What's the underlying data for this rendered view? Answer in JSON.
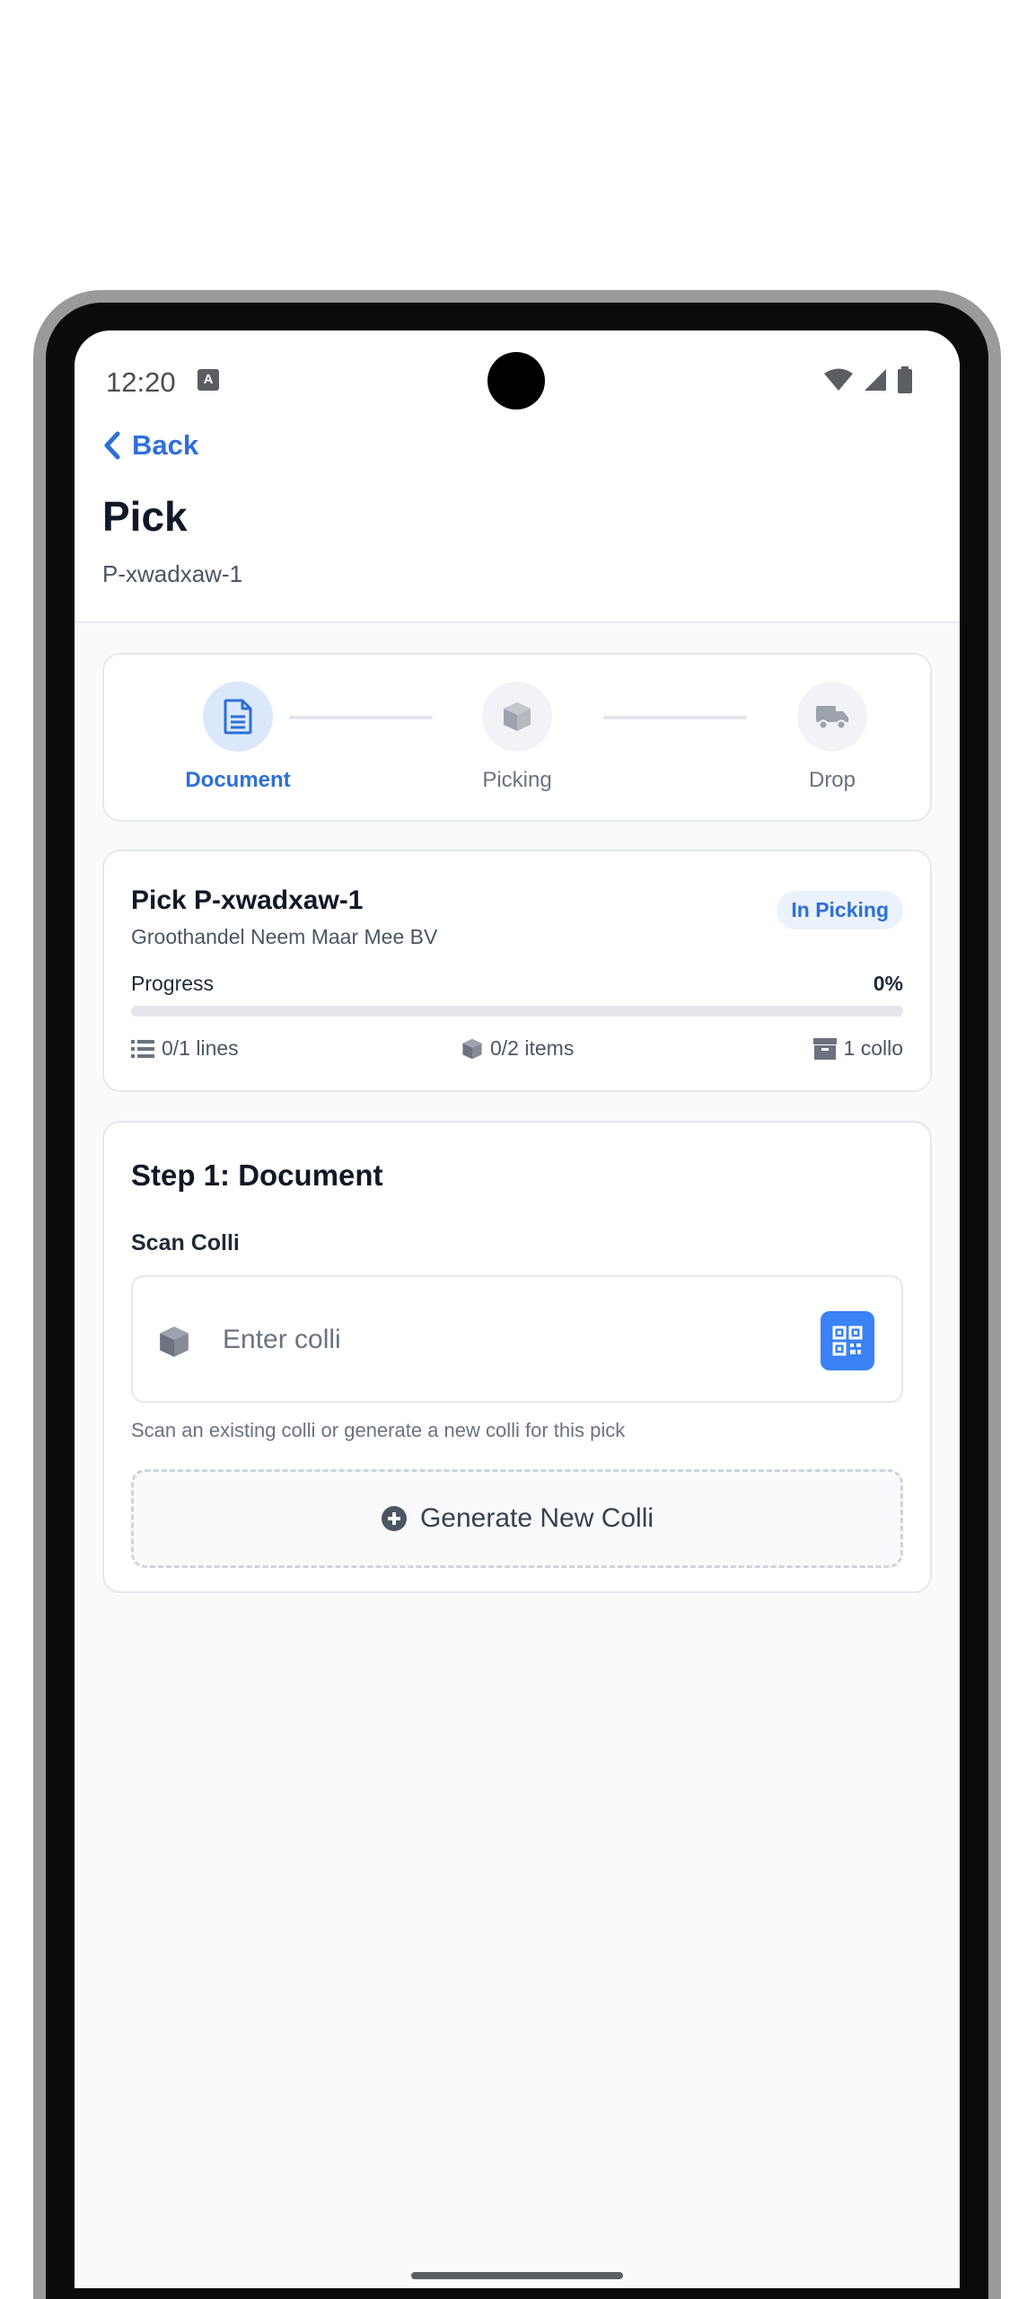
{
  "status_bar": {
    "time": "12:20",
    "notification_icon": "a-icon"
  },
  "header": {
    "back_label": "Back",
    "title": "Pick",
    "subtitle": "P-xwadxaw-1"
  },
  "stepper": {
    "steps": [
      {
        "label": "Document",
        "icon": "document-icon",
        "active": true
      },
      {
        "label": "Picking",
        "icon": "box-icon",
        "active": false
      },
      {
        "label": "Drop",
        "icon": "truck-icon",
        "active": false
      }
    ]
  },
  "summary": {
    "title": "Pick P-xwadxaw-1",
    "customer": "Groothandel Neem Maar Mee BV",
    "status": "In Picking",
    "progress_label": "Progress",
    "progress_text": "0%",
    "progress_fraction": 0,
    "lines": "0/1 lines",
    "items": "0/2 items",
    "collo": "1 collo"
  },
  "step1": {
    "title": "Step 1: Document",
    "scan_label": "Scan Colli",
    "input_placeholder": "Enter colli",
    "input_value": "",
    "helper": "Scan an existing colli or generate a new colli for this pick",
    "generate_label": "Generate New Colli"
  },
  "colors": {
    "accent": "#2e6fd8",
    "qr_button": "#3b82f6",
    "badge_bg": "#eaf2fd"
  }
}
